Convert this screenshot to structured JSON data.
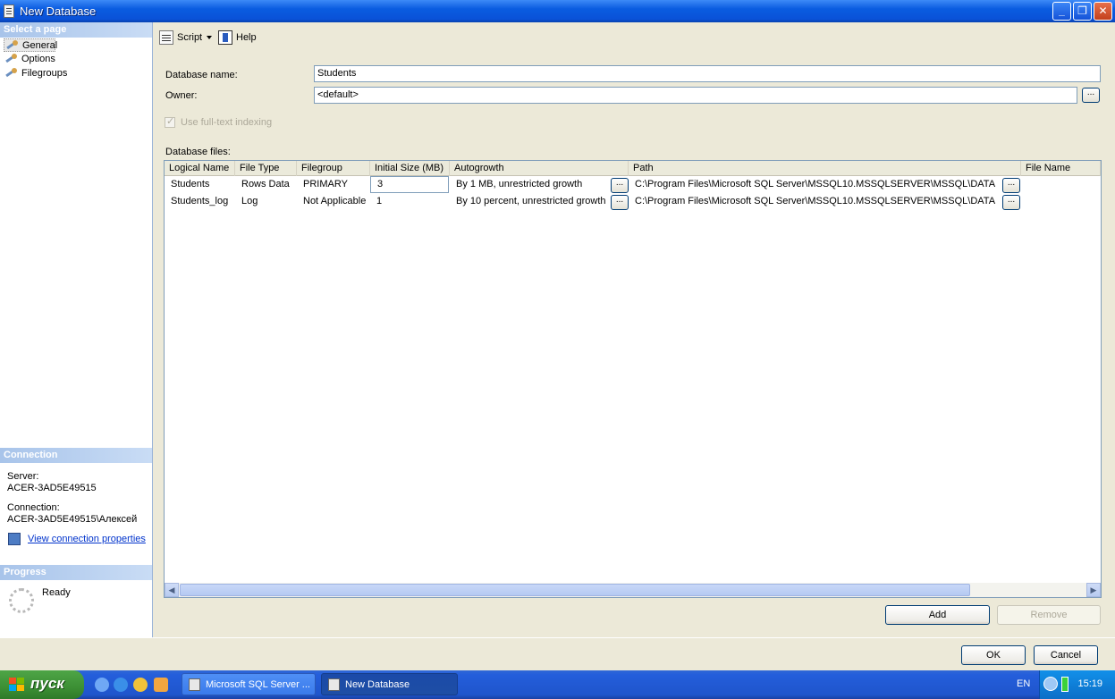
{
  "window": {
    "title": "New Database",
    "controls": [
      "minimize",
      "restore",
      "close"
    ]
  },
  "left": {
    "select_page_header": "Select a page",
    "pages": [
      {
        "label": "General",
        "selected": true
      },
      {
        "label": "Options",
        "selected": false
      },
      {
        "label": "Filegroups",
        "selected": false
      }
    ],
    "connection_header": "Connection",
    "server_label": "Server:",
    "server_value": "ACER-3AD5E49515",
    "connection_label": "Connection:",
    "connection_value": "ACER-3AD5E49515\\Алексей",
    "view_connection_link": "View connection properties",
    "progress_header": "Progress",
    "progress_status": "Ready"
  },
  "toolbar": {
    "script_label": "Script",
    "help_label": "Help"
  },
  "form": {
    "database_name_label": "Database name:",
    "database_name_value": "Students",
    "owner_label": "Owner:",
    "owner_value": "<default>",
    "owner_browse": "...",
    "fulltext_label": "Use full-text indexing",
    "fulltext_checked": true,
    "database_files_label": "Database files:"
  },
  "grid": {
    "columns": [
      "Logical Name",
      "File Type",
      "Filegroup",
      "Initial Size (MB)",
      "Autogrowth",
      "Path",
      "File Name"
    ],
    "rows": [
      {
        "logical_name": "Students",
        "file_type": "Rows Data",
        "filegroup": "PRIMARY",
        "initial_size": "3",
        "autogrowth": "By 1 MB, unrestricted growth",
        "autogrowth_btn": "...",
        "path": "C:\\Program Files\\Microsoft SQL Server\\MSSQL10.MSSQLSERVER\\MSSQL\\DATA",
        "path_btn": "...",
        "file_name": ""
      },
      {
        "logical_name": "Students_log",
        "file_type": "Log",
        "filegroup": "Not Applicable",
        "initial_size": "1",
        "autogrowth": "By 10 percent, unrestricted growth",
        "autogrowth_btn": "...",
        "path": "C:\\Program Files\\Microsoft SQL Server\\MSSQL10.MSSQLSERVER\\MSSQL\\DATA",
        "path_btn": "...",
        "file_name": ""
      }
    ]
  },
  "buttons": {
    "add": "Add",
    "remove": "Remove",
    "ok": "OK",
    "cancel": "Cancel"
  },
  "taskbar": {
    "start_label": "пуск",
    "tasks": [
      {
        "label": "Microsoft SQL Server ...",
        "active": false
      },
      {
        "label": "New Database",
        "active": true
      }
    ],
    "language": "EN",
    "time": "15:19"
  }
}
